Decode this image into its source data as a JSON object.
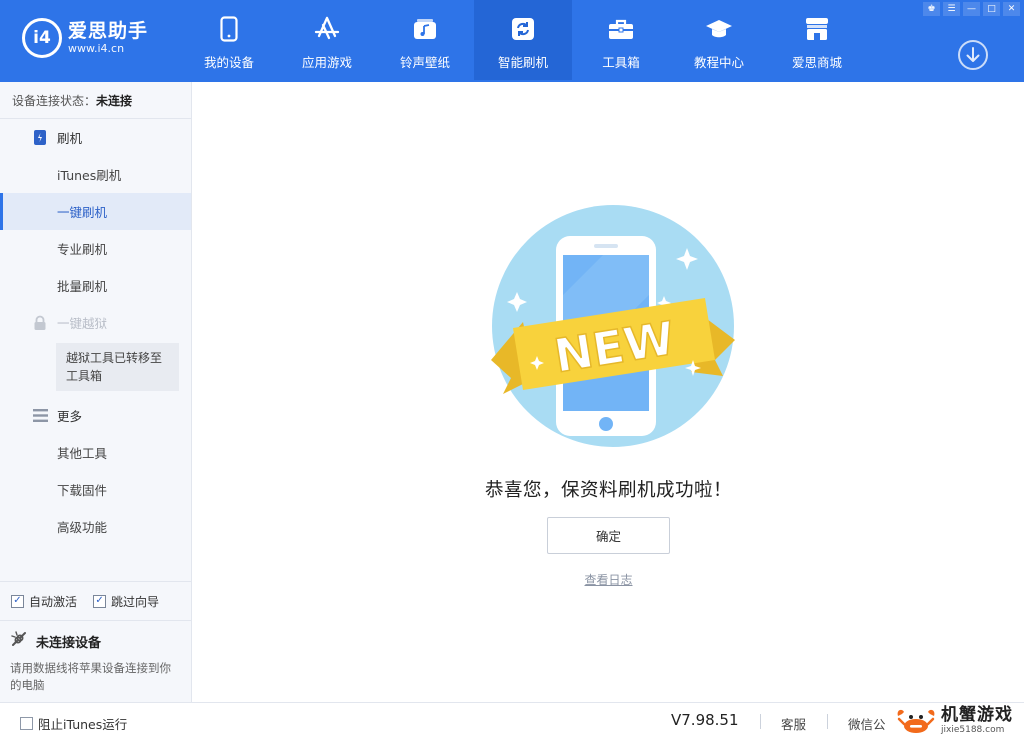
{
  "app": {
    "name": "爱思助手",
    "url": "www.i4.cn",
    "badge": "i4"
  },
  "nav": [
    {
      "label": "我的设备",
      "icon": "phone-icon"
    },
    {
      "label": "应用游戏",
      "icon": "app-store-icon"
    },
    {
      "label": "铃声壁纸",
      "icon": "music-icon"
    },
    {
      "label": "智能刷机",
      "icon": "refresh-icon",
      "active": true
    },
    {
      "label": "工具箱",
      "icon": "toolbox-icon"
    },
    {
      "label": "教程中心",
      "icon": "graduation-cap-icon"
    },
    {
      "label": "爱思商城",
      "icon": "store-icon"
    }
  ],
  "window_controls": {
    "skin": "♚",
    "menu": "☰",
    "minimize": "—",
    "maximize": "□",
    "close": "✕"
  },
  "sidebar": {
    "conn_label": "设备连接状态：",
    "conn_value": "未连接",
    "flash_group": "刷机",
    "flash_items": [
      "iTunes刷机",
      "一键刷机",
      "专业刷机",
      "批量刷机"
    ],
    "active_item": "一键刷机",
    "jailbreak_group": "一键越狱",
    "jailbreak_note": "越狱工具已转移至工具箱",
    "more_group": "更多",
    "more_items": [
      "其他工具",
      "下载固件",
      "高级功能"
    ],
    "auto_activate": "自动激活",
    "skip_guide": "跳过向导",
    "device_title": "未连接设备",
    "device_desc": "请用数据线将苹果设备连接到你的电脑"
  },
  "main": {
    "badge_text": "NEW",
    "success_message": "恭喜您，保资料刷机成功啦！",
    "ok_button": "确定",
    "log_link": "查看日志"
  },
  "footer": {
    "block_itunes": "阻止iTunes运行",
    "version": "V7.98.51",
    "support": "客服",
    "wechat": "微信公",
    "watermark_name": "机蟹游戏",
    "watermark_url": "jixie5188.com"
  },
  "colors": {
    "brand_blue": "#2e74e8",
    "active_nav": "#2466d6",
    "banner_yellow": "#f8d23c",
    "circle_blue": "#a9dcf3"
  }
}
